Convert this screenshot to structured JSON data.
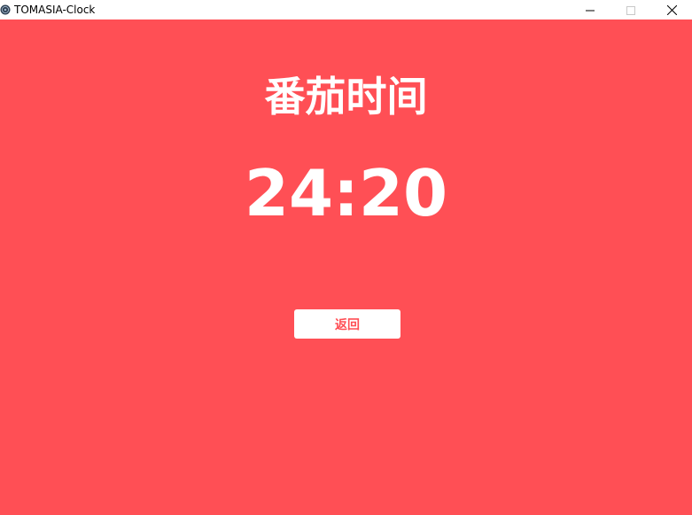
{
  "window": {
    "title": "TOMASIA-Clock",
    "app_icon": "app-logo-icon",
    "controls": {
      "minimize_icon": "minimize-icon",
      "maximize_icon": "maximize-icon",
      "close_icon": "close-icon"
    }
  },
  "main": {
    "heading": "番茄时间",
    "timer": "24:20",
    "back_button_label": "返回"
  },
  "colors": {
    "background": "#ff4f55",
    "text": "#ffffff",
    "button_bg": "#ffffff",
    "button_text": "#ff4f55"
  }
}
